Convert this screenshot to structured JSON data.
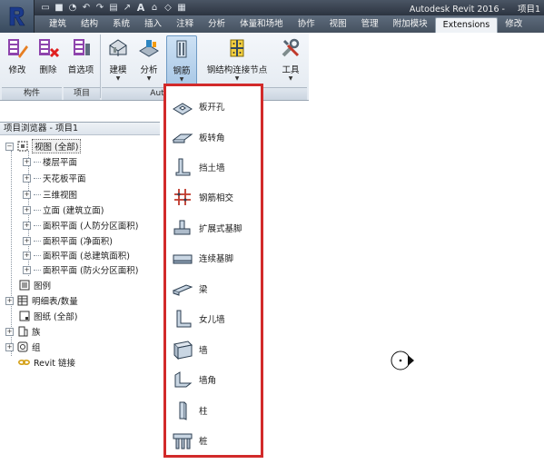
{
  "window": {
    "title": "Autodesk Revit 2016 -",
    "project": "项目1"
  },
  "quick_access": {
    "icons": [
      "folder-open-icon",
      "save-icon",
      "sync-icon",
      "undo-icon",
      "redo-icon",
      "print-icon",
      "measure-icon",
      "text-A-icon",
      "view-icon",
      "tag-icon",
      "switch-windows-icon"
    ]
  },
  "tabs": [
    {
      "label": "建筑",
      "active": false
    },
    {
      "label": "结构",
      "active": false
    },
    {
      "label": "系统",
      "active": false
    },
    {
      "label": "插入",
      "active": false
    },
    {
      "label": "注释",
      "active": false
    },
    {
      "label": "分析",
      "active": false
    },
    {
      "label": "体量和场地",
      "active": false
    },
    {
      "label": "协作",
      "active": false
    },
    {
      "label": "视图",
      "active": false
    },
    {
      "label": "管理",
      "active": false
    },
    {
      "label": "附加模块",
      "active": false
    },
    {
      "label": "Extensions",
      "active": true
    },
    {
      "label": "修改",
      "active": false
    }
  ],
  "ribbon": {
    "buttons": {
      "modify": "修改",
      "delete": "删除",
      "preferences": "首选项",
      "model": "建模",
      "analysis": "分析",
      "rebar": "钢筋",
      "steel_connection": "钢结构连接节点",
      "tools": "工具"
    },
    "panels": {
      "component": "构件",
      "project": "项目",
      "autodesk": "Autodesk Revit Extensions"
    }
  },
  "project_browser": {
    "header": "项目浏览器 - 项目1",
    "items": [
      {
        "label": "视图 (全部)",
        "icon": "views-icon",
        "expanded": true,
        "selected": true
      },
      {
        "label": "楼层平面",
        "expander": "+"
      },
      {
        "label": "天花板平面",
        "expander": "+"
      },
      {
        "label": "三维视图",
        "expander": "+"
      },
      {
        "label": "立面 (建筑立面)",
        "expander": "+"
      },
      {
        "label": "面积平面 (人防分区面积)",
        "expander": "+"
      },
      {
        "label": "面积平面 (净面积)",
        "expander": "+"
      },
      {
        "label": "面积平面 (总建筑面积)",
        "expander": "+"
      },
      {
        "label": "面积平面 (防火分区面积)",
        "expander": "+"
      },
      {
        "label": "图例",
        "icon": "legend-icon"
      },
      {
        "label": "明细表/数量",
        "icon": "schedule-icon",
        "expander": "+"
      },
      {
        "label": "图纸 (全部)",
        "icon": "sheet-icon"
      },
      {
        "label": "族",
        "icon": "family-icon",
        "expander": "+"
      },
      {
        "label": "组",
        "icon": "group-icon",
        "expander": "+"
      },
      {
        "label": "Revit 链接",
        "icon": "link-icon"
      }
    ]
  },
  "rebar_menu": {
    "items": [
      {
        "label": "板开孔",
        "icon": "slab-opening-icon"
      },
      {
        "label": "板转角",
        "icon": "slab-corner-icon"
      },
      {
        "label": "挡土墙",
        "icon": "retaining-wall-icon"
      },
      {
        "label": "钢筋相交",
        "icon": "rebar-intersection-icon"
      },
      {
        "label": "扩展式基脚",
        "icon": "spread-footing-icon"
      },
      {
        "label": "连续基脚",
        "icon": "continuous-footing-icon"
      },
      {
        "label": "梁",
        "icon": "beam-icon"
      },
      {
        "label": "女儿墙",
        "icon": "parapet-icon"
      },
      {
        "label": "墙",
        "icon": "wall-icon"
      },
      {
        "label": "墙角",
        "icon": "wall-corner-icon"
      },
      {
        "label": "柱",
        "icon": "column-icon"
      },
      {
        "label": "桩",
        "icon": "pile-icon"
      }
    ]
  }
}
